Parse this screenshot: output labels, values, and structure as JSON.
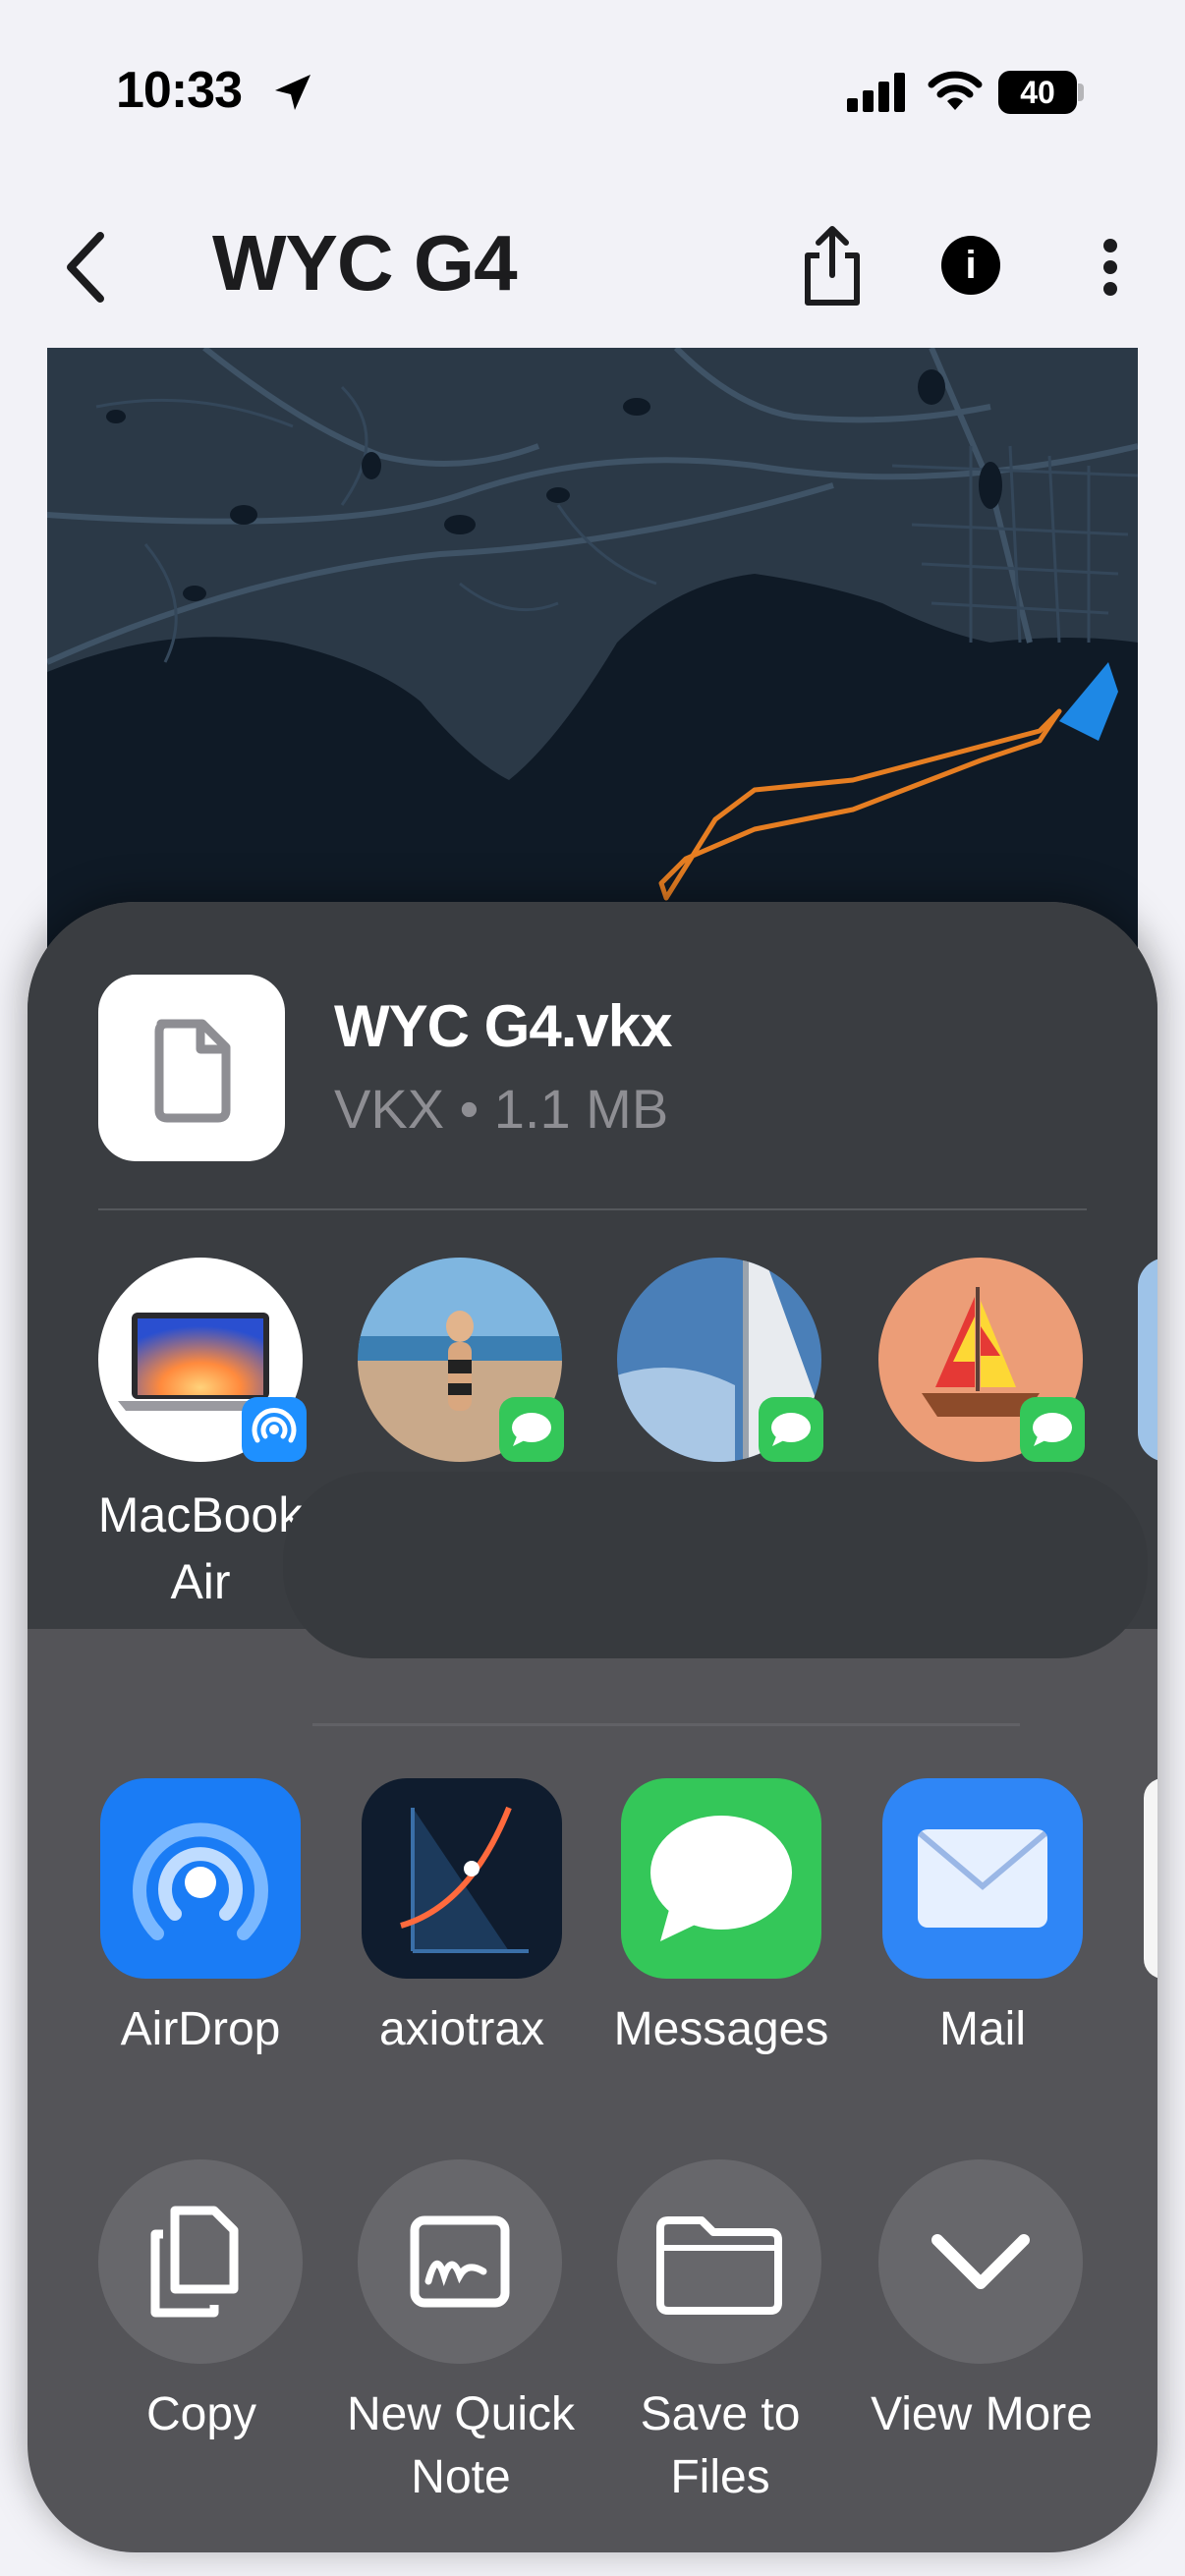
{
  "status_bar": {
    "time": "10:33",
    "battery": "40"
  },
  "nav": {
    "title": "WYC G4"
  },
  "share_sheet": {
    "file": {
      "name": "WYC G4.vkx",
      "meta": "VKX • 1.1 MB"
    },
    "people": [
      {
        "label": "MacBook Air",
        "badge": "airdrop-badge-icon"
      },
      {
        "label": "",
        "badge": "messages-badge-icon"
      },
      {
        "label": "",
        "badge": "messages-badge-icon"
      },
      {
        "label": "",
        "badge": "messages-badge-icon"
      }
    ],
    "apps": [
      {
        "label": "AirDrop",
        "icon": "airdrop-icon"
      },
      {
        "label": "axiotrax",
        "icon": "axiotrax-icon"
      },
      {
        "label": "Messages",
        "icon": "messages-icon"
      },
      {
        "label": "Mail",
        "icon": "mail-icon"
      }
    ],
    "actions": [
      {
        "label": "Copy",
        "icon": "copy-icon"
      },
      {
        "label": "New Quick Note",
        "icon": "quick-note-icon"
      },
      {
        "label": "Save to Files",
        "icon": "folder-icon"
      },
      {
        "label": "View More",
        "icon": "chevron-down-icon"
      }
    ]
  },
  "colors": {
    "track": "#e67e22",
    "boat": "#1e88e5",
    "map_land": "#2c3a47",
    "map_water": "#0f1a26"
  }
}
